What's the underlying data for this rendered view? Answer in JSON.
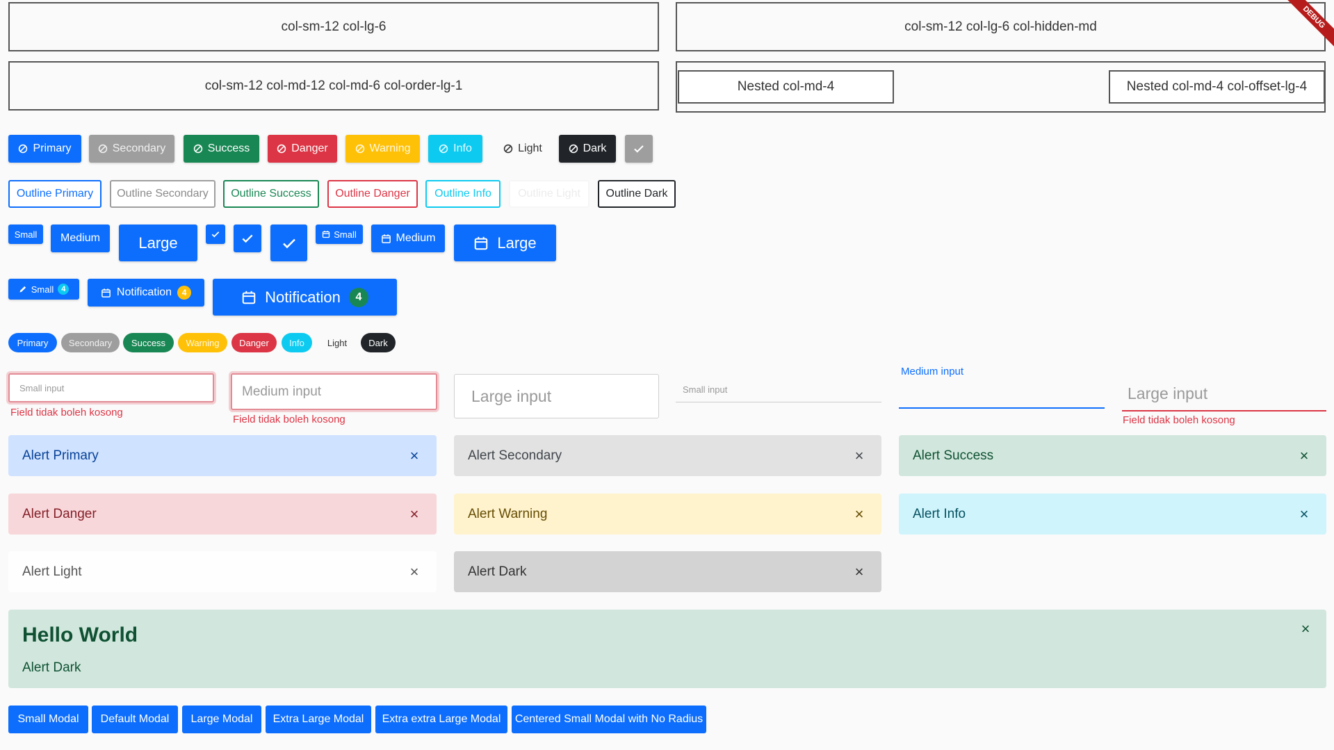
{
  "grid": {
    "box1": "col-sm-12 col-lg-6",
    "box2": "col-sm-12 col-lg-6 col-hidden-md",
    "box3": "col-sm-12 col-md-12 col-md-6 col-order-lg-1",
    "nested1": "Nested col-md-4",
    "nested2": "Nested col-md-4 col-offset-lg-4"
  },
  "debug_banner": "DEBUG",
  "buttons": {
    "primary": "Primary",
    "secondary": "Secondary",
    "success": "Success",
    "danger": "Danger",
    "warning": "Warning",
    "info": "Info",
    "light": "Light",
    "dark": "Dark"
  },
  "outline_buttons": {
    "primary": "Outline Primary",
    "secondary": "Outline Secondary",
    "success": "Outline Success",
    "danger": "Outline Danger",
    "info": "Outline Info",
    "light": "Outline Light",
    "dark": "Outline Dark"
  },
  "sizes": {
    "small": "Small",
    "medium": "Medium",
    "large": "Large"
  },
  "notifications": {
    "small_label": "Small",
    "small_count": "4",
    "medium_label": "Notification",
    "medium_count": "4",
    "large_label": "Notification",
    "large_count": "4"
  },
  "badges": {
    "primary": "Primary",
    "secondary": "Secondary",
    "success": "Success",
    "warning": "Warning",
    "danger": "Danger",
    "info": "Info",
    "light": "Light",
    "dark": "Dark"
  },
  "inputs": {
    "small_placeholder": "Small input",
    "medium_placeholder": "Medium input",
    "large_placeholder": "Large input",
    "error_text": "Field tidak boleh kosong"
  },
  "alerts": {
    "primary": "Alert Primary",
    "secondary": "Alert Secondary",
    "success": "Alert Success",
    "danger": "Alert Danger",
    "warning": "Alert Warning",
    "info": "Alert Info",
    "light": "Alert Light",
    "dark": "Alert Dark",
    "close_glyph": "×"
  },
  "big_alert": {
    "title": "Hello World",
    "body": "Alert Dark"
  },
  "modals": {
    "small": "Small Modal",
    "default": "Default Modal",
    "large": "Large Modal",
    "xl": "Extra Large Modal",
    "xxl": "Extra extra Large Modal",
    "centered": "Centered Small Modal with No Radius"
  },
  "colors": {
    "primary": "#0d6efd",
    "secondary": "#9e9e9e",
    "success": "#198754",
    "danger": "#dc3545",
    "warning": "#ffc107",
    "info": "#0dcaf0",
    "dark": "#212529",
    "debug_banner": "#b71c1c"
  },
  "icons": {
    "block": "block-icon",
    "check": "check-icon",
    "calendar": "calendar-icon",
    "pencil": "pencil-icon",
    "close": "close-icon"
  }
}
